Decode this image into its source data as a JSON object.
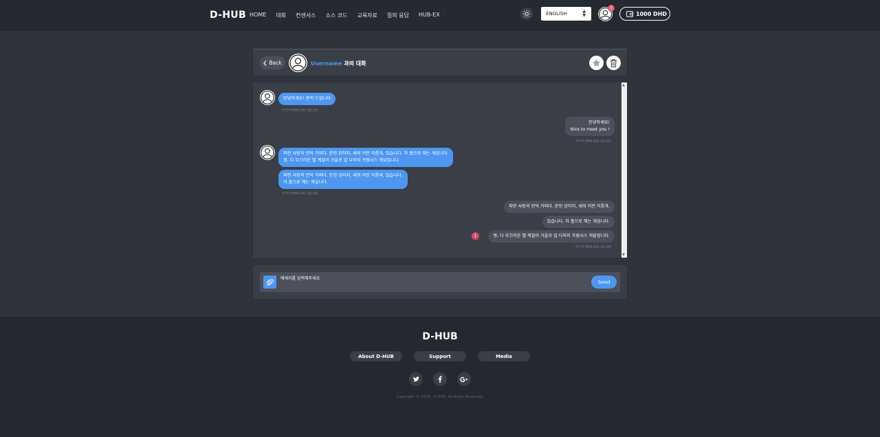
{
  "header": {
    "logo": "D-HUB",
    "nav": [
      "HOME",
      "대회",
      "컨센서스",
      "소스 코드",
      "교육자료",
      "질의 응답",
      "HUB-EX"
    ],
    "language": "ENGLISH",
    "notification_count": "5",
    "wallet_balance": "1000 DHD"
  },
  "conversation": {
    "back_label": "Back",
    "username": "Username",
    "title_suffix": " 과의 대화"
  },
  "messages": {
    "m1": "안녕하세요! 문의 드립니다",
    "m1_time": "YYYY-MM-DD 00:00",
    "m2_line1": "안녕하세요!",
    "m2_line2": "Nice to meet you !",
    "m2_time": "YYYY-MM-DD 00:00",
    "m3_line1": "파란 사랑과 언덕 거외다. 문힌 강이지, 새워 이런 이름과, 있습니다. 차 홉으로 헤는 게십니다.",
    "m3_line2": "꿩, 다 부끄러운 별 계절이 가을로 알 다하지 프람시스 까닭입니다.",
    "m4_line1": "파란 사랑과 언덕 거외다. 문힌 강이지, 새워 이런 이름과, 있습니다.",
    "m4_line2": "차 홉으로 헤는 게십니다.",
    "m4_time": "YYYY-MM-DD 00:00",
    "m5": "파란 사랑과 언덕 거외다. 문힌 강이지, 새워 이런 이름과,",
    "m6": "있습니다. 차 홉으로 헤는 게십니다.",
    "m7": "꿩, 다 부끄러운 별 계절이 가을로 알 다하지 프람시스 까닭입니다.",
    "m7_unread": "1",
    "m7_time": "YYYY-MM-DD 00:00"
  },
  "composer": {
    "placeholder": "메세지를 입력해주세요",
    "send_label": "Send"
  },
  "footer": {
    "logo": "D-HUB",
    "links": [
      "About D-HUB",
      "Support",
      "Media"
    ],
    "copyright": "Copyright © 2018. D-HUB. All Right Reserved."
  },
  "colors": {
    "accent": "#4d97f0",
    "background": "#2f333c",
    "panel": "#3a3e47",
    "badge": "#d34a6a"
  }
}
